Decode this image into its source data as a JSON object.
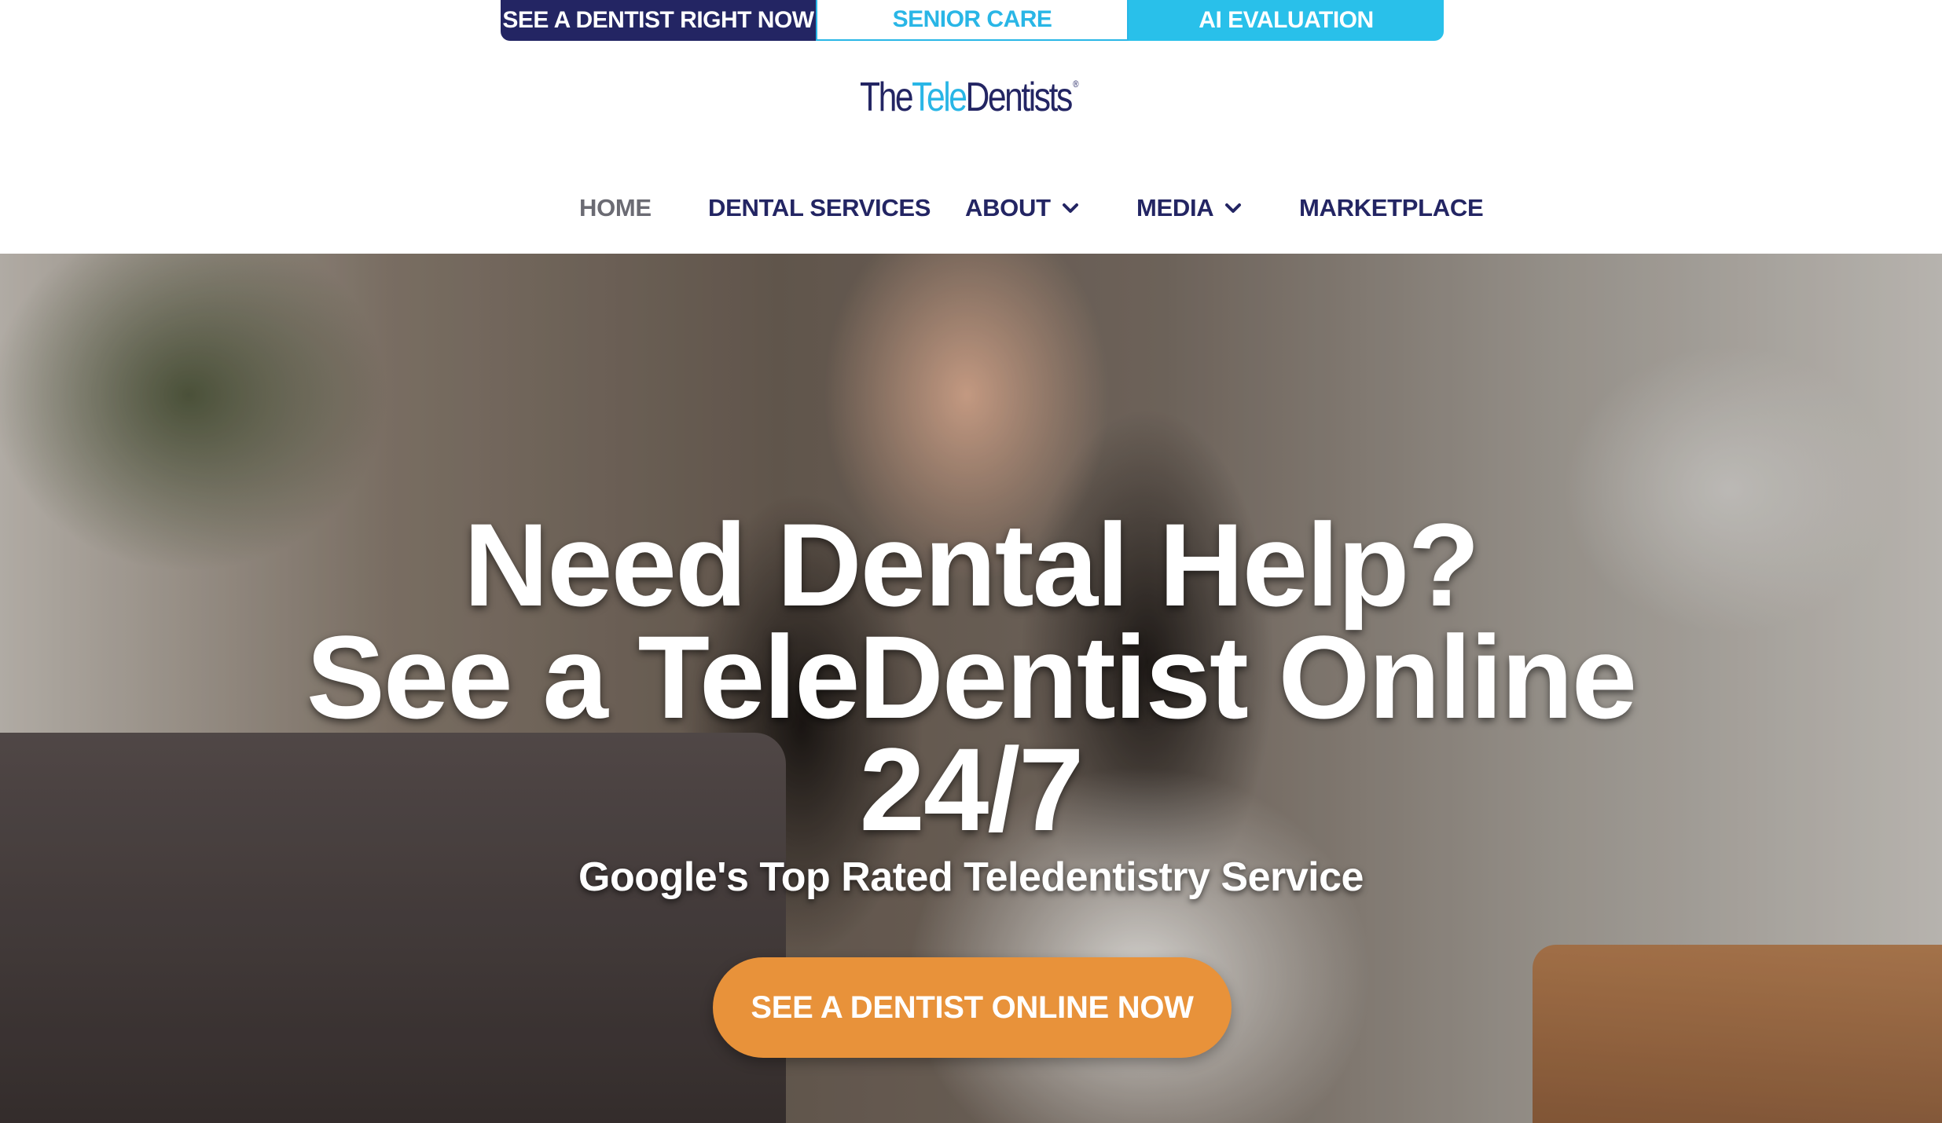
{
  "top_tabs": {
    "see_dentist": "SEE A DENTIST RIGHT NOW",
    "senior_care": "SENIOR CARE",
    "ai_evaluation": "AI EVALUATION"
  },
  "logo": {
    "the": "The",
    "tele": "Tele",
    "dentists": "Dentists",
    "reg": "®"
  },
  "nav": {
    "home": "HOME",
    "dental_services": "DENTAL SERVICES",
    "about": "ABOUT",
    "media": "MEDIA",
    "marketplace": "MARKETPLACE"
  },
  "hero": {
    "headline_line1": "Need Dental Help?",
    "headline_line2": "See a TeleDentist Online",
    "headline_line3": "24/7",
    "subheadline": "Google's Top Rated Teledentistry Service",
    "cta_label": "SEE A DENTIST ONLINE NOW"
  },
  "colors": {
    "navy": "#232563",
    "sky": "#29c0ea",
    "orange": "#e8923a"
  }
}
